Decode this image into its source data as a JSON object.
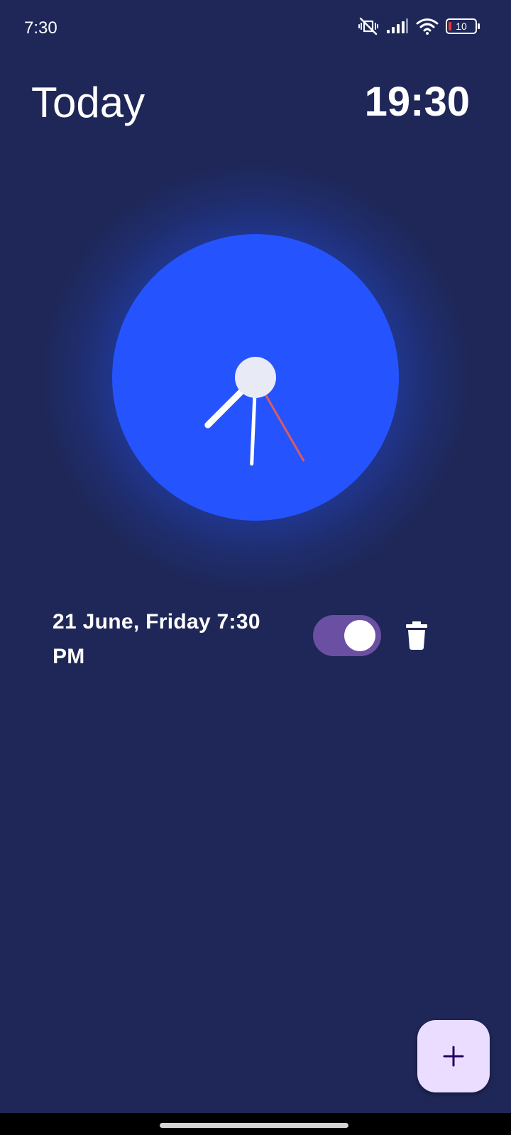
{
  "status_bar": {
    "time": "7:30",
    "battery_level": "10",
    "icons": [
      "vibrate-off-icon",
      "signal-icon",
      "wifi-icon",
      "battery-icon"
    ]
  },
  "header": {
    "title": "Today",
    "current_time": "19:30"
  },
  "clock": {
    "hour": 7,
    "minute": 30,
    "second": 25,
    "face_color": "#2554ff",
    "hand_color": "#ffffff",
    "second_hand_color": "#e05a5a",
    "center_color": "#e8eaf6"
  },
  "alarms": [
    {
      "label": "21 June, Friday 7:30 PM",
      "enabled": true
    }
  ],
  "fab": {
    "icon": "plus-icon"
  },
  "colors": {
    "background": "#1e2757",
    "toggle_track": "#6a4fa3",
    "fab_background": "#eaddff"
  }
}
